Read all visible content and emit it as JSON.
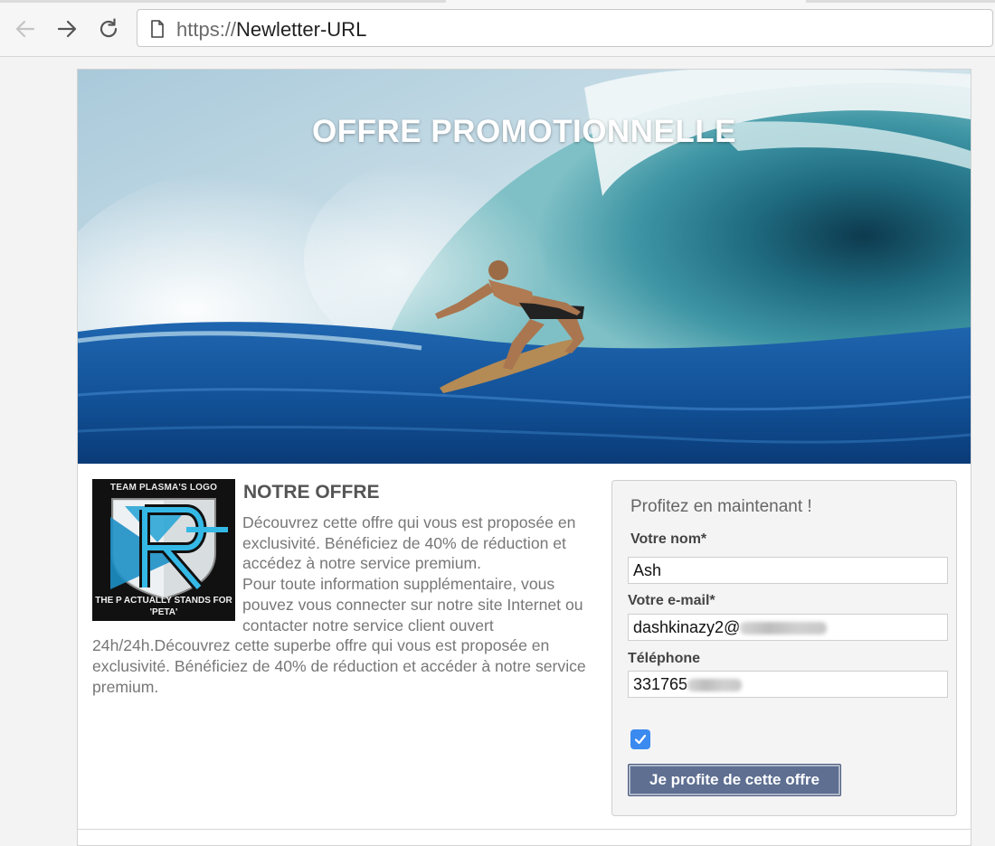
{
  "browser": {
    "url_scheme": "https://",
    "url_host": "Newletter-URL",
    "icons": {
      "back": "back-arrow-icon",
      "forward": "forward-arrow-icon",
      "reload": "reload-icon",
      "page": "page-icon"
    }
  },
  "hero": {
    "title": "OFFRE PROMOTIONNELLE"
  },
  "logo": {
    "top_text": "TEAM PLASMA'S LOGO",
    "bottom_text_line1": "THE P ACTUALLY STANDS FOR",
    "bottom_text_line2": "'PETA'"
  },
  "offer": {
    "title": "NOTRE OFFRE",
    "paragraph1": "Découvrez cette offre qui vous est proposée en exclusivité. Bénéficiez de 40% de réduction et accédez à notre service premium.",
    "paragraph2": "Pour toute information supplémentaire, vous pouvez vous connecter sur notre site Internet ou contacter notre service client ouvert 24h/24h.Découvrez cette superbe offre qui vous est proposée en exclusivité. Bénéficiez de 40% de réduction et accéder à notre service premium."
  },
  "form": {
    "title": "Profitez en maintenant !",
    "name_label": "Votre nom*",
    "name_value": "Ash",
    "email_label": "Votre e-mail*",
    "email_value": "dashkinazy2@",
    "phone_label": "Téléphone",
    "phone_value": "331765",
    "checkbox_checked": true,
    "submit_label": "Je profite de cette offre"
  },
  "colors": {
    "checkbox": "#3b8af0",
    "button": "#5e6f92",
    "ocean": "#1d5fa0"
  }
}
